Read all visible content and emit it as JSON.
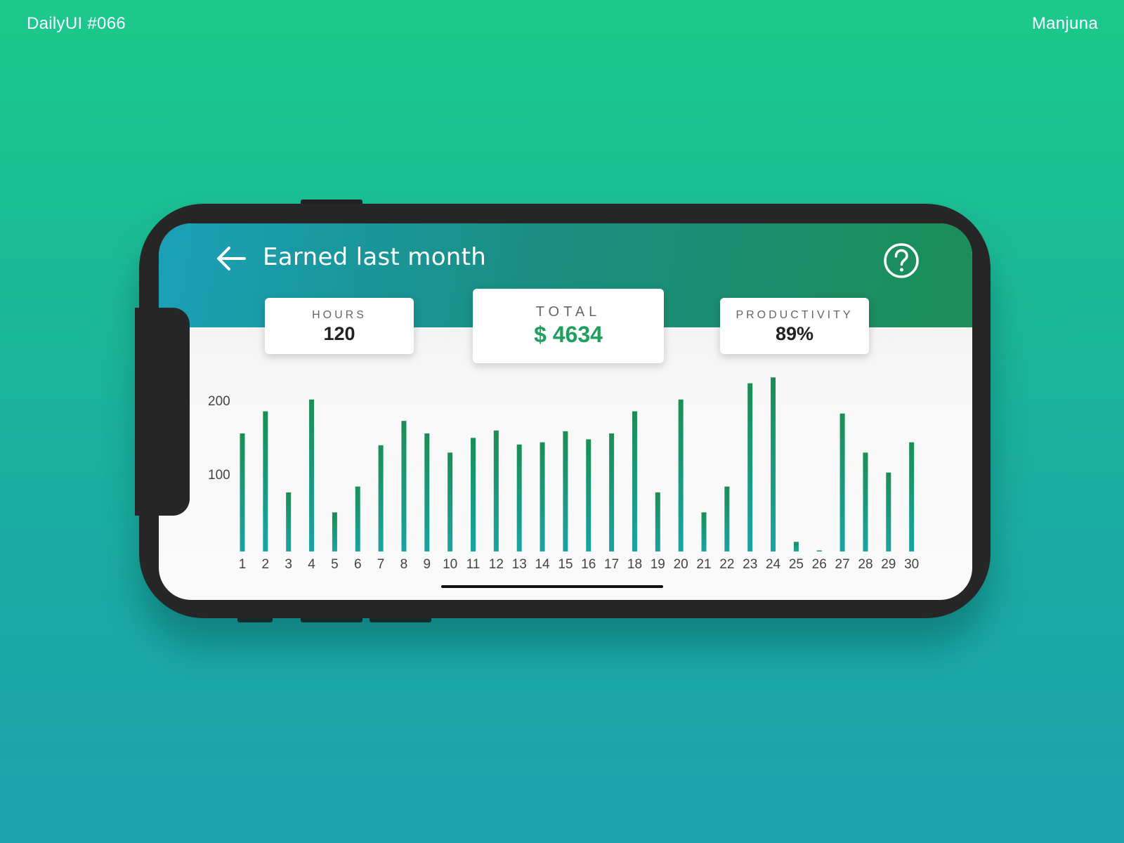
{
  "page": {
    "tag": "DailyUI #066",
    "author": "Manjuna"
  },
  "header": {
    "title": "Earned last month",
    "back_icon": "arrow-left-icon",
    "help_icon": "question-circle-icon"
  },
  "stats": {
    "hours": {
      "label": "HOURS",
      "value": "120"
    },
    "total": {
      "label": "TOTAL",
      "value": "$ 4634"
    },
    "productivity": {
      "label": "PRODUCTIVITY",
      "value": "89%"
    }
  },
  "colors": {
    "background_top": "#1cc98a",
    "background_bottom": "#1aa1ae",
    "accent_green": "#1e9f5d",
    "bar_top": "#1b8e55",
    "bar_bottom": "#1aa3a3"
  },
  "chart_data": {
    "type": "bar",
    "categories": [
      "1",
      "2",
      "3",
      "4",
      "5",
      "6",
      "7",
      "8",
      "9",
      "10",
      "11",
      "12",
      "13",
      "14",
      "15",
      "16",
      "17",
      "18",
      "19",
      "20",
      "21",
      "22",
      "23",
      "24",
      "25",
      "26",
      "27",
      "28",
      "29",
      "30"
    ],
    "values": [
      160,
      190,
      80,
      206,
      53,
      88,
      144,
      177,
      160,
      134,
      154,
      164,
      145,
      148,
      163,
      152,
      160,
      190,
      80,
      206,
      53,
      88,
      228,
      236,
      13,
      1,
      187,
      134,
      107,
      148
    ],
    "yticks": [
      "100",
      "200"
    ],
    "ylim": [
      0,
      240
    ],
    "grid": false
  }
}
